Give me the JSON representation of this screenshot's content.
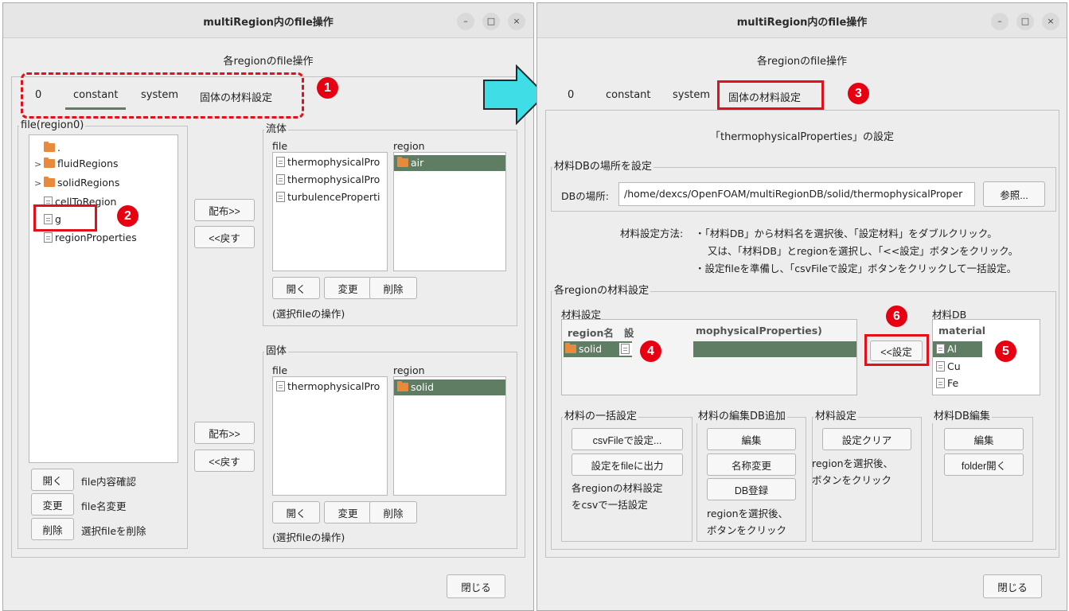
{
  "left": {
    "title": "multiRegion内のfile操作",
    "heading": "各regionのfile操作",
    "tabs": [
      "0",
      "constant",
      "system",
      "固体の材料設定"
    ],
    "file_group_title": "file(region0)",
    "tree": [
      ".",
      "fluidRegions",
      "solidRegions",
      "cellToRegion",
      "g",
      "regionProperties"
    ],
    "buttons": {
      "open": "開く",
      "rename": "変更",
      "delete": "削除"
    },
    "button_descs": {
      "open": "file内容確認",
      "rename": "file名変更",
      "delete": "選択fileを削除"
    },
    "distribute": "配布>>",
    "back": "<<戻す",
    "fluid": {
      "title": "流体",
      "file_header": "file",
      "region_header": "region",
      "files": [
        "thermophysicalPro",
        "thermophysicalPro",
        "turbulenceProperti"
      ],
      "regions": [
        "air"
      ],
      "caption": "(選択fileの操作)"
    },
    "solid": {
      "title": "固体",
      "file_header": "file",
      "region_header": "region",
      "files": [
        "thermophysicalPro"
      ],
      "regions": [
        "solid"
      ],
      "caption": "(選択fileの操作)"
    },
    "close": "閉じる"
  },
  "right": {
    "title": "multiRegion内のfile操作",
    "heading": "各regionのfile操作",
    "tabs": [
      "0",
      "constant",
      "system",
      "固体の材料設定"
    ],
    "subtitle": "「thermophysicalProperties」の設定",
    "db_group_title": "材料DBの場所を設定",
    "db_label": "DBの場所:",
    "db_path": "/home/dexcs/OpenFOAM/multiRegionDB/solid/thermophysicalProper",
    "browse": "参照...",
    "method_label": "材料設定方法:",
    "method_lines": [
      "・「材料DB」から材料名を選択後、「設定材料」をダブルクリック。",
      "又は、「材料DB」とregionを選択し、「<<設定」ボタンをクリック。",
      "・設定fileを準備し、「csvFileで設定」ボタンをクリックして一括設定。"
    ],
    "region_group_title": "各regionの材料設定",
    "material_setting": "材料設定",
    "table_headers": [
      "region名",
      "設",
      "mophysicalProperties)"
    ],
    "table_rows": [
      {
        "region": "solid"
      }
    ],
    "set_button": "<<設定",
    "db_list_title": "材料DB",
    "db_list_header": "material",
    "materials": [
      "Al",
      "Cu",
      "Fe"
    ],
    "bulk": {
      "title": "材料の一括設定",
      "csv": "csvFileで設定...",
      "export": "設定をfileに出力",
      "desc": [
        "各regionの材料設定",
        "をcsvで一括設定"
      ]
    },
    "edit_db": {
      "title": "材料の編集DB追加",
      "edit": "編集",
      "rename": "名称変更",
      "register": "DB登録",
      "desc": [
        "regionを選択後、",
        "ボタンをクリック"
      ]
    },
    "mat_set": {
      "title": "材料設定",
      "clear": "設定クリア",
      "desc": [
        "regionを選択後、",
        "ボタンをクリック"
      ]
    },
    "db_edit": {
      "title": "材料DB編集",
      "edit": "編集",
      "folder": "folder開く"
    },
    "close": "閉じる"
  },
  "annotations": [
    "1",
    "2",
    "3",
    "4",
    "5",
    "6"
  ],
  "window_controls": [
    "–",
    "□",
    "×"
  ],
  "colors": {
    "highlight": "#5f7d62",
    "annotation_red": "#e60012",
    "arrow": "#3fdde6"
  }
}
